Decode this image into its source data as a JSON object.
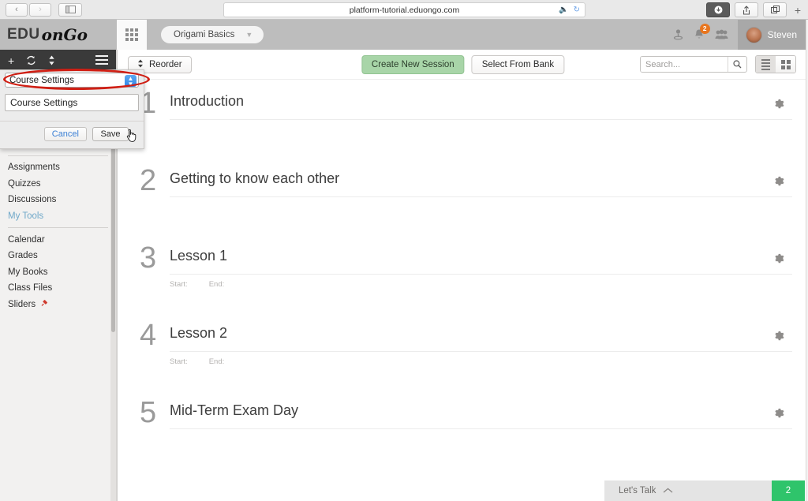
{
  "browser": {
    "url": "platform-tutorial.eduongo.com",
    "back_icon": "chevron-left-icon",
    "forward_icon": "chevron-right-icon",
    "sidebar_icon": "sidebar-toggle-icon",
    "speaker_icon": "⦿",
    "reload_icon": "↻",
    "download_icon": "↓",
    "share_icon": "⇧",
    "tabs_icon": "⧉",
    "newtab_icon": "+"
  },
  "header": {
    "logo_primary": "EDU",
    "logo_secondary": "onGo",
    "apps_icon": "grid-apps-icon",
    "course_name": "Origami Basics",
    "course_chevron": "⌄",
    "icons": [
      {
        "name": "profile-icon",
        "glyph": "♁"
      },
      {
        "name": "notifications-icon",
        "glyph": "△",
        "badge": "2"
      },
      {
        "name": "people-icon",
        "glyph": "⚉"
      }
    ],
    "user_name": "Steven"
  },
  "sidebar": {
    "toolbar": {
      "add_icon": "+",
      "refresh_icon": "↻",
      "sort_icon": "⇅",
      "menu_icon": "☰"
    },
    "items": [
      {
        "label": "Assignments",
        "type": "link"
      },
      {
        "label": "Quizzes",
        "type": "link"
      },
      {
        "label": "Discussions",
        "type": "link"
      },
      {
        "label": "My Tools",
        "type": "section"
      },
      {
        "label": "Calendar",
        "type": "link"
      },
      {
        "label": "Grades",
        "type": "link"
      },
      {
        "label": "My Books",
        "type": "link"
      },
      {
        "label": "Class Files",
        "type": "link"
      },
      {
        "label": "Sliders",
        "type": "link",
        "icon": "slider-pin-icon"
      }
    ]
  },
  "settings_popup": {
    "select_value": "Course Settings",
    "stepper_icon": "⇅",
    "input_value": "Course Settings",
    "cancel_label": "Cancel",
    "save_label": "Save"
  },
  "toolbar": {
    "reorder_label": "Reorder",
    "reorder_icon": "⇅",
    "create_session_label": "Create New Session",
    "select_bank_label": "Select From Bank",
    "search_placeholder": "Search...",
    "search_value": "",
    "search_icon": "⌕",
    "list_view_icon": "list-view-icon",
    "grid_view_icon": "grid-view-icon"
  },
  "sessions": [
    {
      "number": "1",
      "title": "Introduction",
      "start_label": "",
      "end_label": "",
      "gear_icon": "⚙"
    },
    {
      "number": "2",
      "title": "Getting to know each other",
      "start_label": "",
      "end_label": "",
      "gear_icon": "⚙"
    },
    {
      "number": "3",
      "title": "Lesson 1",
      "start_label": "Start:",
      "end_label": "End:",
      "gear_icon": "⚙"
    },
    {
      "number": "4",
      "title": "Lesson 2",
      "start_label": "Start:",
      "end_label": "End:",
      "gear_icon": "⚙"
    },
    {
      "number": "5",
      "title": "Mid-Term Exam Day",
      "start_label": "",
      "end_label": "",
      "gear_icon": "⚙"
    }
  ],
  "chat": {
    "label": "Let's Talk",
    "chevron_icon": "⌃",
    "count": "2"
  },
  "colors": {
    "accent_green": "#a8d5a8",
    "badge_orange": "#e8761f",
    "chat_green": "#2fc46b",
    "annotation_red": "#d01f14",
    "section_blue": "#6fa8c9"
  }
}
